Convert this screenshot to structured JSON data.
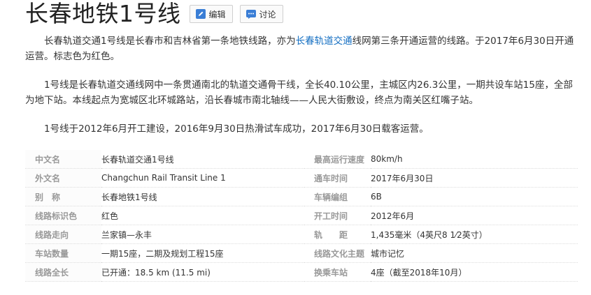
{
  "header": {
    "title": "长春地铁1号线",
    "edit_label": "编辑",
    "discuss_label": "讨论"
  },
  "paragraphs": {
    "p1_before_link": "长春轨道交通1号线是长春市和吉林省第一条地铁线路，亦为",
    "p1_link": "长春轨道交通",
    "p1_after_link": "线网第三条开通运营的线路。于2017年6月30日开通运营。标志色为红色。",
    "p2": "1号线是长春轨道交通线网中一条贯通南北的轨道交通骨干线，全长40.10公里，主城区内26.3公里，一期共设车站15座，全部为地下站。本线起点为宽城区北环城路站，沿长春城市南北轴线——人民大街敷设，终点为南关区红嘴子站。",
    "p3": "1号线于2012年6月开工建设，2016年9月30日热滑试车成功，2017年6月30日载客运营。"
  },
  "infobox": {
    "rows": [
      {
        "k1": "中文名",
        "v1": "长春轨道交通1号线",
        "k2": "最高运行速度",
        "v2": "80km/h"
      },
      {
        "k1": "外文名",
        "v1": "Changchun Rail Transit Line 1",
        "k2": "通车时间",
        "v2": "2017年6月30日"
      },
      {
        "k1": "别　称",
        "v1": "长春地铁1号线",
        "k2": "车辆编组",
        "v2": "6B"
      },
      {
        "k1": "线路标识色",
        "v1": "红色",
        "k2": "开工时间",
        "v2": "2012年6月"
      },
      {
        "k1": "线路走向",
        "v1": "兰家镇—永丰",
        "k2": "轨　　距",
        "v2": "1,435毫米（4英尺8 1⁄2英寸）"
      },
      {
        "k1": "车站数量",
        "v1": "一期15座，二期及规划工程15座",
        "k2": "线路文化主题",
        "v2": "城市记忆"
      },
      {
        "k1": "线路全长",
        "v1": "已开通：18.5 km (11.5 mi)",
        "k2": "换乘车站",
        "v2": "4座（截至2018年10月）"
      }
    ]
  },
  "icons": {
    "edit": "pencil-icon",
    "discuss": "chat-bubble-icon"
  },
  "colors": {
    "link": "#136ec2",
    "icon_blue": "#3a7ed6"
  }
}
